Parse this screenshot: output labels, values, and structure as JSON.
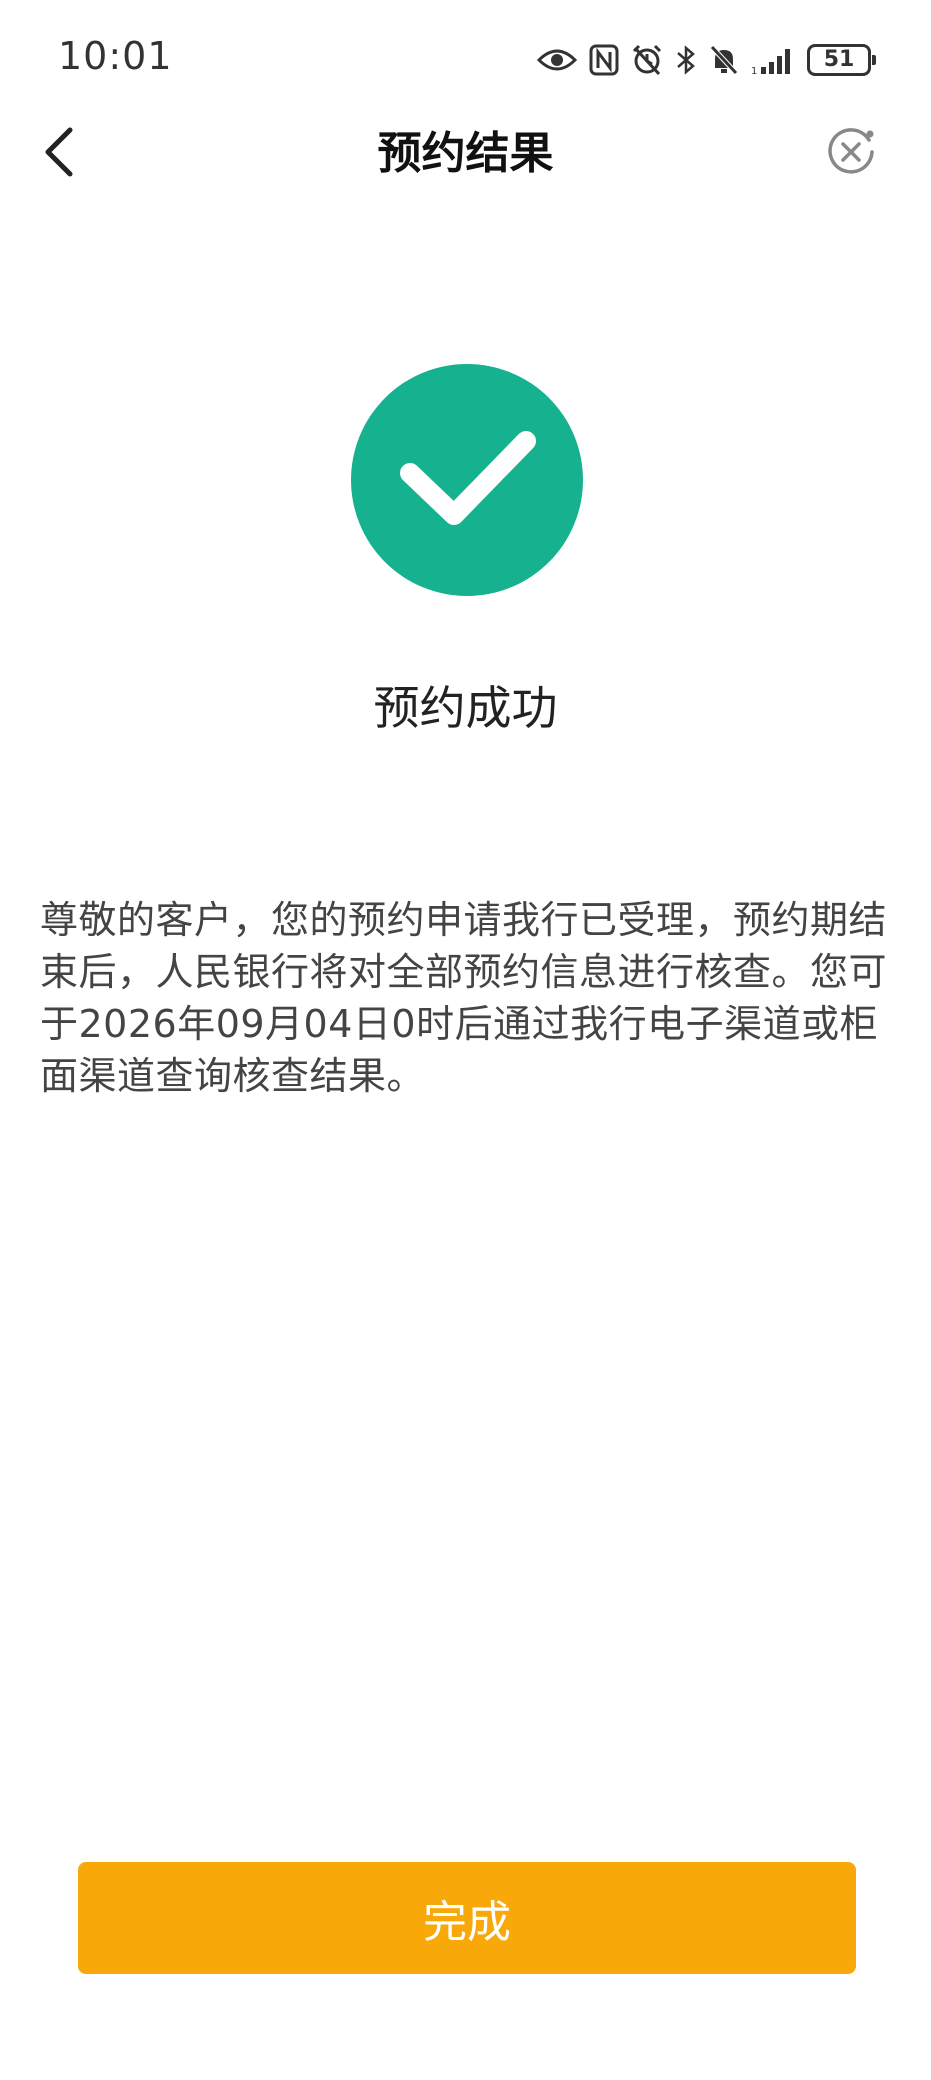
{
  "status_bar": {
    "time": "10:01",
    "battery": "51",
    "icons": [
      "eye-icon",
      "nfc-icon",
      "alarm-icon",
      "bluetooth-icon",
      "mute-icon",
      "signal-icon",
      "battery-icon"
    ]
  },
  "nav": {
    "title": "预约结果",
    "back_icon": "chevron-left-icon",
    "close_icon": "close-circle-icon"
  },
  "result": {
    "icon": "check-icon",
    "title": "预约成功",
    "message": "尊敬的客户，您的预约申请我行已受理，预约期结束后，人民银行将对全部预约信息进行核查。您可于2026年09月04日0时后通过我行电子渠道或柜面渠道查询核查结果。"
  },
  "actions": {
    "done_label": "完成"
  },
  "colors": {
    "success": "#16B28F",
    "primary_button": "#F9A80A",
    "text_primary": "#222222",
    "text_secondary": "#444444",
    "icon_gray": "#888888"
  }
}
